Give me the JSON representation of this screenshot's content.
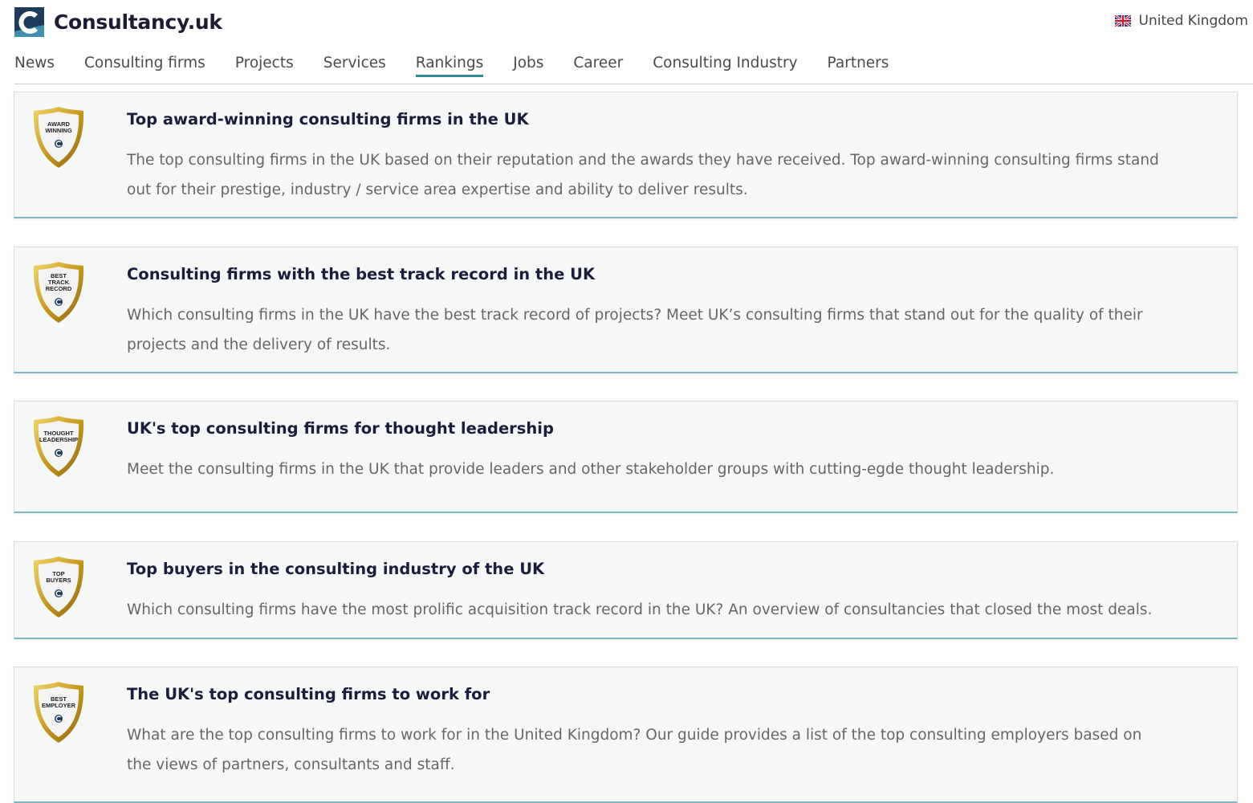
{
  "site": {
    "brand": "Consultancy.uk",
    "country": "United Kingdom"
  },
  "nav": {
    "items": [
      "News",
      "Consulting firms",
      "Projects",
      "Services",
      "Rankings",
      "Jobs",
      "Career",
      "Consulting Industry",
      "Partners"
    ],
    "active": "Rankings"
  },
  "colors": {
    "brand_navy": "#1d3b5c",
    "accent_teal": "#2f8a9a",
    "badge_gold": "#c9a227"
  },
  "rankings": [
    {
      "badge_lines": [
        "AWARD",
        "WINNING"
      ],
      "title": "Top award-winning consulting firms in the UK",
      "description": "The top consulting firms in the UK based on their reputation and the awards they have received. Top award-winning consulting firms stand out for their prestige, industry / service area expertise and ability to deliver results."
    },
    {
      "badge_lines": [
        "BEST",
        "TRACK",
        "RECORD"
      ],
      "title": "Consulting firms with the best track record in the UK",
      "description": "Which consulting firms in the UK have the best track record of projects? Meet UK’s consulting firms that stand out for the quality of their projects and the delivery of results."
    },
    {
      "badge_lines": [
        "THOUGHT",
        "LEADERSHIP"
      ],
      "title": "UK's top consulting firms for thought leadership",
      "description": "Meet the consulting firms in the UK that provide leaders and other stakeholder groups with cutting-egde thought leadership."
    },
    {
      "badge_lines": [
        "TOP",
        "BUYERS"
      ],
      "title": "Top buyers in the consulting industry of the UK",
      "description": "Which consulting firms have the most prolific acquisition track record in the UK? An overview of consultancies that closed the most deals."
    },
    {
      "badge_lines": [
        "BEST",
        "EMPLOYER"
      ],
      "title": "The UK's top consulting firms to work for",
      "description": "What are the top consulting firms to work for in the United Kingdom? Our guide provides a list of the top consulting employers based on the views of partners, consultants and staff."
    }
  ]
}
